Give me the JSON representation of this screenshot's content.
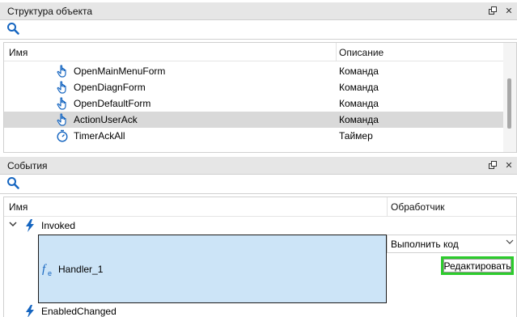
{
  "object_panel": {
    "title": "Структура объекта",
    "columns": {
      "name": "Имя",
      "description": "Описание"
    },
    "rows": [
      {
        "name": "OpenMainMenuForm",
        "description": "Команда",
        "icon": "hand-pointer-icon",
        "selected": false
      },
      {
        "name": "OpenDiagnForm",
        "description": "Команда",
        "icon": "hand-pointer-icon",
        "selected": false
      },
      {
        "name": "OpenDefaultForm",
        "description": "Команда",
        "icon": "hand-pointer-icon",
        "selected": false
      },
      {
        "name": "ActionUserAck",
        "description": "Команда",
        "icon": "hand-pointer-icon",
        "selected": true
      },
      {
        "name": "TimerAckAll",
        "description": "Таймер",
        "icon": "stopwatch-icon",
        "selected": false
      }
    ]
  },
  "events_panel": {
    "title": "События",
    "columns": {
      "name": "Имя",
      "handler": "Обработчик"
    },
    "events": [
      {
        "name": "Invoked",
        "expanded": true,
        "icon": "lightning-bolt-icon"
      },
      {
        "name": "EnabledChanged",
        "expanded": false,
        "icon": "lightning-bolt-icon"
      }
    ],
    "handler": {
      "name": "Handler_1",
      "icon": "function-icon",
      "action_select": "Выполнить код",
      "edit_button": "Редактировать"
    }
  },
  "colors": {
    "header_bg": "#e6e6e6",
    "selection_bg": "#d9d9d9",
    "handler_bg": "#cce4f7",
    "accent_blue": "#1565c0",
    "highlight_green": "#2ccc2c"
  }
}
